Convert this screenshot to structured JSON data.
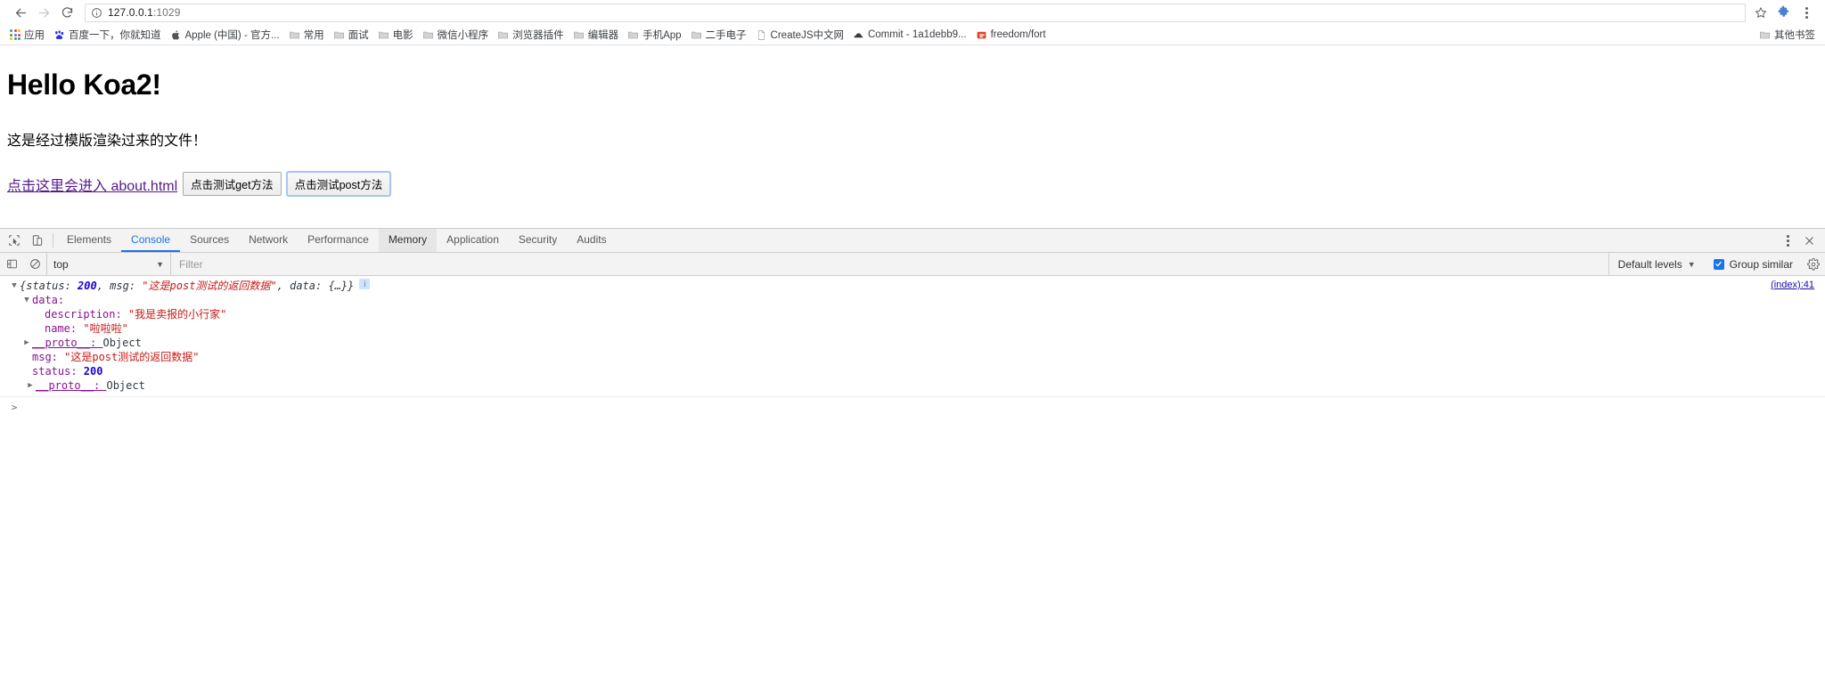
{
  "browser": {
    "nav": {
      "back_label": "Back",
      "forward_label": "Forward",
      "reload_label": "Reload"
    },
    "omnibox": {
      "host": "127.0.0.1",
      "port": ":1029",
      "info_icon": "info-circle-icon",
      "star_icon": "star-outline-icon"
    },
    "menu_icon": "three-dots-vertical-icon",
    "extension_icon": "extension-puzzle-icon"
  },
  "bookmarks": {
    "apps_label": "应用",
    "items": [
      {
        "label": "百度一下，你就知道",
        "icon": "baidu-paw-icon",
        "color": "#2932e1"
      },
      {
        "label": "Apple (中国) - 官方...",
        "icon": "apple-logo-icon",
        "color": "#555555"
      },
      {
        "label": "常用",
        "icon": "folder-icon",
        "color": "#b9b9b9"
      },
      {
        "label": "面试",
        "icon": "folder-icon",
        "color": "#b9b9b9"
      },
      {
        "label": "电影",
        "icon": "folder-icon",
        "color": "#b9b9b9"
      },
      {
        "label": "微信小程序",
        "icon": "folder-icon",
        "color": "#b9b9b9"
      },
      {
        "label": "浏览器插件",
        "icon": "folder-icon",
        "color": "#b9b9b9"
      },
      {
        "label": "编辑器",
        "icon": "folder-icon",
        "color": "#b9b9b9"
      },
      {
        "label": "手机App",
        "icon": "folder-icon",
        "color": "#b9b9b9"
      },
      {
        "label": "二手电子",
        "icon": "folder-icon",
        "color": "#b9b9b9"
      },
      {
        "label": "CreateJS中文网",
        "icon": "page-icon",
        "color": "#9e9e9e"
      },
      {
        "label": "Commit - 1a1debb9...",
        "icon": "cloud-icon",
        "color": "#3c3c3c"
      },
      {
        "label": "freedom/fort",
        "icon": "gitlab-icon",
        "color": "#e24329"
      }
    ],
    "other_bookmarks": {
      "label": "其他书签",
      "icon": "folder-icon"
    }
  },
  "page": {
    "title": "Hello Koa2!",
    "paragraph": "这是经过模版渲染过来的文件！",
    "about_link": "点击这里会进入 about.html",
    "get_button": "点击测试get方法",
    "post_button": "点击测试post方法"
  },
  "devtools": {
    "tabs": [
      {
        "label": "Elements",
        "state": "normal"
      },
      {
        "label": "Console",
        "state": "active"
      },
      {
        "label": "Sources",
        "state": "normal"
      },
      {
        "label": "Network",
        "state": "normal"
      },
      {
        "label": "Performance",
        "state": "normal"
      },
      {
        "label": "Memory",
        "state": "hovered"
      },
      {
        "label": "Application",
        "state": "normal"
      },
      {
        "label": "Security",
        "state": "normal"
      },
      {
        "label": "Audits",
        "state": "normal"
      }
    ],
    "inspect_icon": "inspect-cursor-icon",
    "device_icon": "device-toolbar-icon",
    "more_icon": "three-dots-vertical-icon",
    "close_icon": "close-x-icon",
    "filterbar": {
      "execute_icon": "sidebar-toggle-icon",
      "clear_icon": "clear-console-icon",
      "context": "top",
      "context_caret": "▼",
      "filter_placeholder": "Filter",
      "levels": "Default levels",
      "levels_caret": "▼",
      "group_similar": "Group similar",
      "group_similar_checked": true,
      "settings_icon": "gear-icon"
    },
    "console": {
      "source_link": "(index):41",
      "info_badge": "i",
      "summary": {
        "open_brace": "{",
        "k_status": "status: ",
        "v_status": "200",
        "sep1": ", ",
        "k_msg": "msg: ",
        "v_msg": "\"这是post测试的返回数据\"",
        "sep2": ", ",
        "k_data": "data: ",
        "v_data": "{…}",
        "close_brace": "}"
      },
      "rows": [
        {
          "indent": 1,
          "tri": "open",
          "key": "data:",
          "value": "",
          "vtype": "none"
        },
        {
          "indent": 2,
          "tri": "blank",
          "key": "description: ",
          "value": "\"我是卖报的小行家\"",
          "vtype": "string"
        },
        {
          "indent": 2,
          "tri": "blank",
          "key": "name: ",
          "value": "\"啦啦啦\"",
          "vtype": "string"
        },
        {
          "indent": 2,
          "tri": "closed",
          "key": "__proto__: ",
          "value": "Object",
          "vtype": "object"
        },
        {
          "indent": 1,
          "tri": "blank",
          "key": "msg: ",
          "value": "\"这是post测试的返回数据\"",
          "vtype": "string"
        },
        {
          "indent": 1,
          "tri": "blank",
          "key": "status: ",
          "value": "200",
          "vtype": "number"
        },
        {
          "indent": 1,
          "tri": "closed",
          "key": "__proto__: ",
          "value": "Object",
          "vtype": "object"
        }
      ],
      "prompt": ">"
    }
  }
}
